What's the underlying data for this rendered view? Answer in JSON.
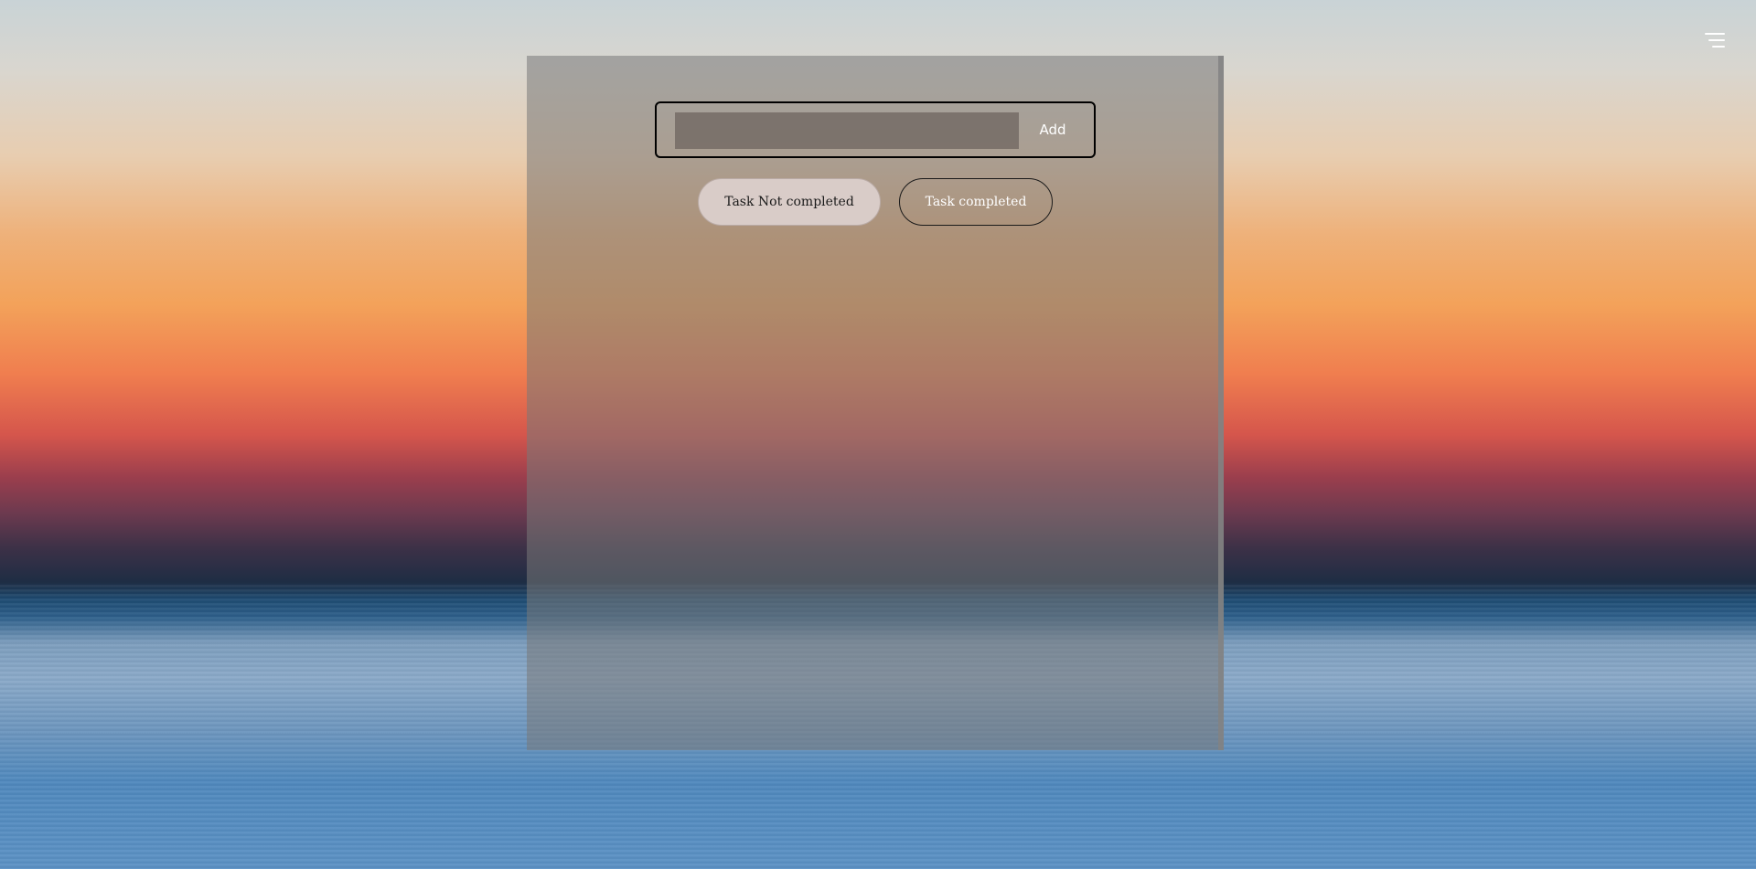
{
  "header": {
    "menu_icon": "hamburger-menu-icon"
  },
  "todo": {
    "input": {
      "value": "",
      "placeholder": ""
    },
    "add_label": "Add",
    "filters": [
      {
        "label": "Task Not completed",
        "active": true
      },
      {
        "label": "Task completed",
        "active": false
      }
    ]
  },
  "colors": {
    "panel_overlay": "#787878",
    "active_filter_bg": "#d9ccc8",
    "text_light": "#ffffff",
    "border_dark": "#000000"
  }
}
